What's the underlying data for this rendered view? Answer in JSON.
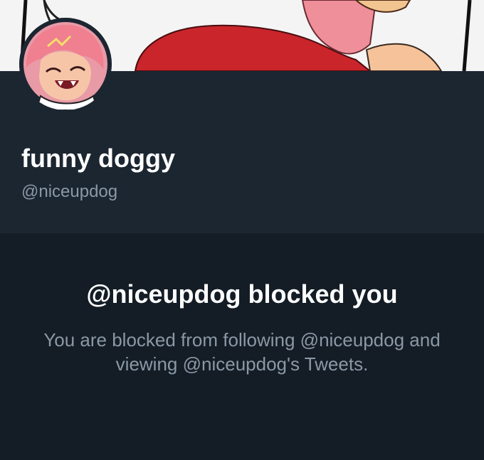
{
  "profile": {
    "display_name": "funny doggy",
    "handle": "@niceupdog"
  },
  "blocked": {
    "title": "@niceupdog blocked you",
    "description": "You are blocked from following @niceupdog and viewing @niceupdog's Tweets."
  },
  "colors": {
    "banner_bg": "#f2f2f2",
    "profile_bg": "#1b2631",
    "page_bg": "#141d26",
    "primary_text": "#ffffff",
    "secondary_text": "#8b98a5"
  }
}
